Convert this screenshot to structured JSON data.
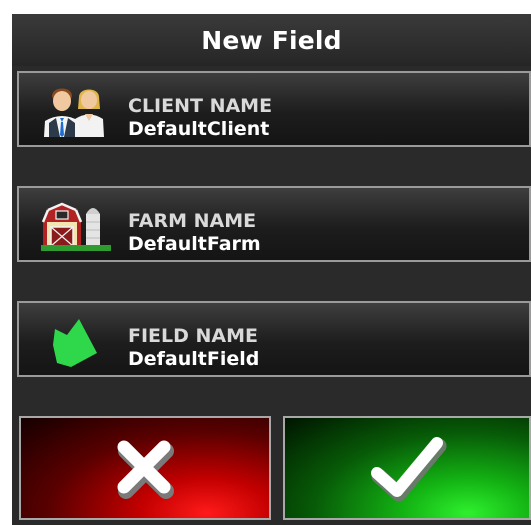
{
  "dialog": {
    "title": "New Field"
  },
  "fields": [
    {
      "label": "CLIENT NAME",
      "value": "DefaultClient",
      "icon": "client-people-icon"
    },
    {
      "label": "FARM NAME",
      "value": "DefaultFarm",
      "icon": "farm-barn-icon"
    },
    {
      "label": "FIELD NAME",
      "value": "DefaultField",
      "icon": "field-shape-icon"
    }
  ],
  "actions": {
    "cancel_icon": "x-icon",
    "confirm_icon": "checkmark-icon"
  },
  "colors": {
    "cancel": "#d10000",
    "confirm": "#18c018",
    "field_green": "#2fd84a"
  }
}
